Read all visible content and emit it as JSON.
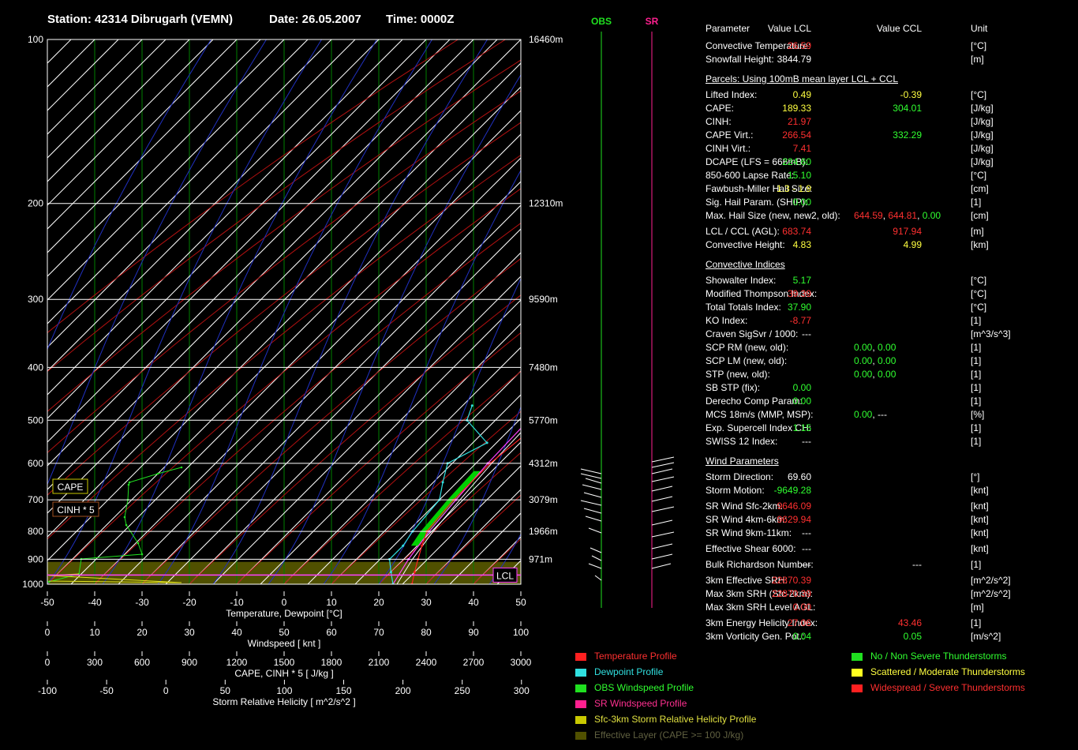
{
  "header": {
    "station": "Station: 42314 Dibrugarh (VEMN)",
    "date": "Date: 26.05.2007",
    "time": "Time: 0000Z"
  },
  "colors": {
    "temperature": "#ff2020",
    "dewpoint": "#30e0e0",
    "obs_wind": "#20e020",
    "sr_wind": "#ff2090",
    "srh": "#c8c800",
    "effective": "#505000",
    "parcel": "#ff40ff",
    "grid": "#ffffff",
    "isotherm": "#008000"
  },
  "chart_data": {
    "type": "line",
    "title": "",
    "xlabel": "Temperature, Dewpoint [°C]",
    "ylabel": "",
    "xlim": [
      -50,
      50
    ],
    "x_ticks": [
      "-50",
      "-40",
      "-30",
      "-20",
      "-10",
      "0",
      "10",
      "20",
      "30",
      "40",
      "50"
    ],
    "pressure_levels": [
      {
        "p": 100,
        "label": "100",
        "height": "16460m"
      },
      {
        "p": 200,
        "label": "200",
        "height": "12310m"
      },
      {
        "p": 300,
        "label": "300",
        "height": "9590m"
      },
      {
        "p": 400,
        "label": "400",
        "height": "7480m"
      },
      {
        "p": 500,
        "label": "500",
        "height": "5770m"
      },
      {
        "p": 600,
        "label": "600",
        "height": "4312m"
      },
      {
        "p": 700,
        "label": "700",
        "height": "3079m"
      },
      {
        "p": 800,
        "label": "800",
        "height": "1966m"
      },
      {
        "p": 900,
        "label": "900",
        "height": "971m"
      },
      {
        "p": 1000,
        "label": "1000",
        "height": ""
      }
    ],
    "lcl_p": 900,
    "series": [
      {
        "name": "Temperature Profile",
        "points": [
          [
            1000,
            27
          ],
          [
            950,
            25
          ],
          [
            900,
            23
          ],
          [
            850,
            21
          ],
          [
            800,
            19
          ],
          [
            700,
            18
          ],
          [
            600,
            18
          ],
          [
            500,
            20
          ],
          [
            400,
            22
          ],
          [
            300,
            22
          ],
          [
            250,
            17
          ],
          [
            200,
            14
          ],
          [
            150,
            19
          ],
          [
            100,
            34
          ]
        ]
      },
      {
        "name": "Dewpoint Profile",
        "points": [
          [
            1000,
            23
          ],
          [
            950,
            20
          ],
          [
            900,
            17
          ],
          [
            850,
            17
          ],
          [
            800,
            16
          ],
          [
            700,
            15
          ],
          [
            650,
            12
          ],
          [
            600,
            9
          ],
          [
            550,
            13
          ],
          [
            500,
            4
          ],
          [
            470,
            2
          ]
        ]
      },
      {
        "name": "Parcel",
        "points": [
          [
            1000,
            23
          ],
          [
            900,
            21
          ],
          [
            800,
            19.5
          ],
          [
            700,
            18.5
          ],
          [
            600,
            17.5
          ],
          [
            500,
            17
          ],
          [
            400,
            17.5
          ],
          [
            300,
            17
          ],
          [
            250,
            15
          ],
          [
            200,
            12
          ],
          [
            150,
            14
          ],
          [
            100,
            18
          ]
        ]
      }
    ],
    "wind_axis": {
      "label": "Windspeed  [ knt ]",
      "ticks": [
        "0",
        "10",
        "20",
        "30",
        "40",
        "50",
        "60",
        "70",
        "80",
        "90",
        "100"
      ]
    },
    "cape_axis": {
      "label": "CAPE, CINH * 5  [ J/kg ]",
      "ticks": [
        "0",
        "300",
        "600",
        "900",
        "1200",
        "1500",
        "1800",
        "2100",
        "2400",
        "2700",
        "3000"
      ]
    },
    "srh_axis": {
      "label": "Storm Relative Helicity  [ m^2/s^2 ]",
      "ticks": [
        "-100",
        "-50",
        "0",
        "50",
        "100",
        "150",
        "200",
        "250",
        "300"
      ]
    },
    "cape_tag": "CAPE",
    "cinh_tag": "CINH * 5",
    "lcl_tag": "LCL"
  },
  "wind_columns": {
    "obs": "OBS",
    "sr": "SR"
  },
  "params": {
    "head": {
      "p": "Parameter",
      "lcl": "Value LCL",
      "ccl": "Value CCL",
      "u": "Unit"
    },
    "rows": [
      {
        "y": 22,
        "p": "Convective Temperature:",
        "v1": "26.59",
        "c1": "#ff3030",
        "v2": "",
        "c2": "#fff",
        "u": "[°C]"
      },
      {
        "y": 39,
        "p": "Snowfall Height:",
        "v1": "3844.79",
        "c1": "#ffffff",
        "v2": "",
        "c2": "#fff",
        "u": "[m]"
      },
      {
        "y": 84,
        "p": "Lifted Index:",
        "v1": "0.49",
        "c1": "#ffff40",
        "v2": "-0.39",
        "c2": "#ffff40",
        "u": "[°C]"
      },
      {
        "y": 101,
        "p": "CAPE:",
        "v1": "189.33",
        "c1": "#ffff40",
        "v2": "304.01",
        "c2": "#30ff30",
        "u": "[J/kg]"
      },
      {
        "y": 118,
        "p": "CINH:",
        "v1": "21.97",
        "c1": "#ff3030",
        "v2": "",
        "c2": "#fff",
        "u": "[J/kg]"
      },
      {
        "y": 135,
        "p": "CAPE Virt.:",
        "v1": "266.54",
        "c1": "#ff3030",
        "v2": "332.29",
        "c2": "#30ff30",
        "u": "[J/kg]"
      },
      {
        "y": 152,
        "p": "CINH Virt.:",
        "v1": "7.41",
        "c1": "#ff3030",
        "v2": "",
        "c2": "#fff",
        "u": "[J/kg]"
      },
      {
        "y": 169,
        "p": "DCAPE (LFS = 666mB):",
        "v1": "224.60",
        "c1": "#30ff30",
        "v2": "",
        "c2": "#fff",
        "u": "[J/kg]"
      },
      {
        "y": 186,
        "p": "850-600 Lapse Rate:",
        "v1": "15.10",
        "c1": "#30ff30",
        "v2": "",
        "c2": "#fff",
        "u": "[°C]"
      },
      {
        "y": 203,
        "p": "Fawbush-Miller Hail Size:",
        "v1": "1.3 - 1.9",
        "c1": "#ffff40",
        "v2": "",
        "c2": "#fff",
        "u": "[cm]"
      },
      {
        "y": 220,
        "p": "Sig. Hail Param. (SHIP):",
        "v1": "0.00",
        "c1": "#30ff30",
        "v2": "",
        "c2": "#fff",
        "u": "[1]"
      },
      {
        "y": 257,
        "p": "LCL / CCL (AGL):",
        "v1": "683.74",
        "c1": "#ff3030",
        "v2": "917.94",
        "c2": "#ff3030",
        "u": "[m]"
      },
      {
        "y": 274,
        "p": "Convective Height:",
        "v1": "4.83",
        "c1": "#ffff40",
        "v2": "4.99",
        "c2": "#ffff40",
        "u": "[km]"
      },
      {
        "y": 319,
        "p": "Showalter Index:",
        "v1": "5.17",
        "c1": "#30ff30",
        "v2": "",
        "c2": "#fff",
        "u": "[°C]"
      },
      {
        "y": 336,
        "p": "Modified Thompson Index:",
        "v1": "39.39",
        "c1": "#ff3030",
        "v2": "",
        "c2": "#fff",
        "u": "[°C]"
      },
      {
        "y": 353,
        "p": "Total Totals Index:",
        "v1": "37.90",
        "c1": "#30ff30",
        "v2": "",
        "c2": "#fff",
        "u": "[°C]"
      },
      {
        "y": 370,
        "p": "KO Index:",
        "v1": "-8.77",
        "c1": "#ff3030",
        "v2": "",
        "c2": "#fff",
        "u": "[1]"
      },
      {
        "y": 387,
        "p": "Craven SigSvr / 1000:",
        "v1": "---",
        "c1": "#ffffff",
        "v2": "",
        "c2": "#fff",
        "u": "[m^3/s^3]"
      },
      {
        "y": 455,
        "p": "SB STP (fix):",
        "v1": "0.00",
        "c1": "#30ff30",
        "v2": "",
        "c2": "#fff",
        "u": "[1]"
      },
      {
        "y": 472,
        "p": "Derecho Comp Param:",
        "v1": "0.00",
        "c1": "#30ff30",
        "v2": "",
        "c2": "#fff",
        "u": "[1]"
      },
      {
        "y": 506,
        "p": "Exp. Supercell Index CH:",
        "v1": "1.15",
        "c1": "#30ff30",
        "v2": "",
        "c2": "#fff",
        "u": "[1]"
      },
      {
        "y": 523,
        "p": "SWISS 12 Index:",
        "v1": "---",
        "c1": "#ffffff",
        "v2": "",
        "c2": "#fff",
        "u": "[1]"
      },
      {
        "y": 568,
        "p": "Storm Direction:",
        "v1": "69.60",
        "c1": "#ffffff",
        "v2": "",
        "c2": "#fff",
        "u": "[°]"
      },
      {
        "y": 585,
        "p": "Storm Motion:",
        "v1": "-9649.28",
        "c1": "#30ff30",
        "v2": "",
        "c2": "#fff",
        "u": "[knt]"
      },
      {
        "y": 605,
        "p": "SR Wind Sfc-2km:",
        "v1": "9646.09",
        "c1": "#ff3030",
        "v2": "",
        "c2": "#fff",
        "u": "[knt]"
      },
      {
        "y": 622,
        "p": "SR Wind 4km-6km:",
        "v1": "9629.94",
        "c1": "#ff3030",
        "v2": "",
        "c2": "#fff",
        "u": "[knt]"
      },
      {
        "y": 639,
        "p": "SR Wind 9km-11km:",
        "v1": "---",
        "c1": "#ffffff",
        "v2": "",
        "c2": "#fff",
        "u": "[knt]"
      },
      {
        "y": 659,
        "p": "Effective Shear 6000:",
        "v1": "---",
        "c1": "#ffffff",
        "v2": "",
        "c2": "#fff",
        "u": "[knt]"
      },
      {
        "y": 679,
        "p": "Bulk Richardson Number:",
        "v1": "---",
        "c1": "#ffffff",
        "v2": "---",
        "c2": "#ffffff",
        "u": "[1]"
      },
      {
        "y": 699,
        "p": "3km Effective SRH:",
        "v1": "22870.39",
        "c1": "#ff3030",
        "v2": "",
        "c2": "#fff",
        "u": "[m^2/s^2]"
      },
      {
        "y": 716,
        "p": "Max 3km SRH (Sfc-2km):",
        "v1": "22870.39",
        "c1": "#ff3030",
        "v2": "",
        "c2": "#fff",
        "u": "[m^2/s^2]"
      },
      {
        "y": 733,
        "p": "Max 3km SRH Level AGL:",
        "v1": "0.00",
        "c1": "#ff3030",
        "v2": "",
        "c2": "#fff",
        "u": "[m]"
      },
      {
        "y": 753,
        "p": "3km Energy Helicity Index:",
        "v1": "27.06",
        "c1": "#ff3030",
        "v2": "43.46",
        "c2": "#ff3030",
        "u": "[1]"
      },
      {
        "y": 770,
        "p": "3km Vorticity Gen. Pot.:",
        "v1": "0.04",
        "c1": "#30ff30",
        "v2": "0.05",
        "c2": "#30ff30",
        "u": "[m/s^2]"
      }
    ],
    "multi": [
      {
        "y": 237,
        "p": "Max. Hail Size (new, new2, old):",
        "a": "644.59",
        "ca": "#ff3030",
        "b": "644.81",
        "cb": "#ff3030",
        "c": "0.00",
        "cc": "#30ff30",
        "u": "[cm]"
      },
      {
        "y": 404,
        "p": "SCP RM (new, old):",
        "a": "0.00",
        "ca": "#30ff30",
        "b": "0.00",
        "cb": "#30ff30",
        "c": "",
        "cc": "#fff",
        "u": "[1]"
      },
      {
        "y": 421,
        "p": "SCP LM (new, old):",
        "a": "0.00",
        "ca": "#30ff30",
        "b": "0.00",
        "cb": "#30ff30",
        "c": "",
        "cc": "#fff",
        "u": "[1]"
      },
      {
        "y": 438,
        "p": "STP (new, old):",
        "a": "0.00",
        "ca": "#30ff30",
        "b": "0.00",
        "cb": "#30ff30",
        "c": "",
        "cc": "#fff",
        "u": "[1]"
      },
      {
        "y": 489,
        "p": "MCS 18m/s (MMP, MSP):",
        "a": "0.00",
        "ca": "#30ff30",
        "b": "---",
        "cb": "#ffffff",
        "c": "",
        "cc": "#fff",
        "u": "[%]"
      }
    ],
    "sections": [
      {
        "y": 64,
        "t": "Parcels: Using 100mB mean layer LCL + CCL"
      },
      {
        "y": 299,
        "t": "Convective Indices"
      },
      {
        "y": 548,
        "t": "Wind Parameters"
      }
    ]
  },
  "legend": {
    "left": [
      {
        "t": "Temperature Profile",
        "c": "#ff2020",
        "tc": "#ff3030"
      },
      {
        "t": "Dewpoint Profile",
        "c": "#30e0e0",
        "tc": "#30e0e0"
      },
      {
        "t": "OBS Windspeed Profile",
        "c": "#20e020",
        "tc": "#30ff30"
      },
      {
        "t": "SR Windspeed Profile",
        "c": "#ff2090",
        "tc": "#ff3090"
      },
      {
        "t": "Sfc-3km Storm Relative Helicity Profile",
        "c": "#c8c800",
        "tc": "#e0e040"
      },
      {
        "t": "Effective Layer (CAPE >= 100 J/kg)",
        "c": "#505000",
        "tc": "#606040"
      }
    ],
    "right": [
      {
        "t": "No / Non Severe Thunderstorms",
        "c": "#20e020",
        "tc": "#30ff30"
      },
      {
        "t": "Scattered / Moderate Thunderstorms",
        "c": "#ffff20",
        "tc": "#ffff40"
      },
      {
        "t": "Widespread / Severe Thunderstorms",
        "c": "#ff2020",
        "tc": "#ff3030"
      }
    ]
  }
}
